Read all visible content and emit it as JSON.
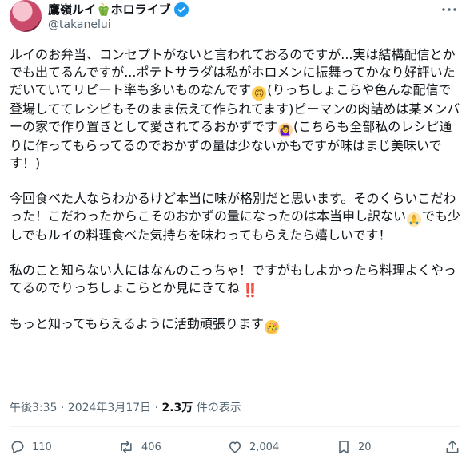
{
  "author": {
    "display_name": "鷹嶺ルイ🫑ホロライブ",
    "handle": "@takanelui"
  },
  "post": {
    "paragraph1": {
      "text_a": "ルイのお弁当、コンセプトがないと言われておるのですが...実は結構配信とかでも出てるんですが...ポテトサラダは私がホロメンに振舞ってかなり好評いただいていてリピート率も多いものなんです",
      "emoji_a": "🙃",
      "text_b": "(りっちしょこらや色んな配信で登場しててレシピもそのまま伝えて作られてます)ピーマンの肉詰めは某メンバーの家で作り置きとして愛されてるおかずです",
      "emoji_b": "🙋‍♀️",
      "text_c": "(こちらも全部私のレシピ通りに作ってもらってるのでおかずの量は少ないかもですが味はまじ美味いです！)"
    },
    "paragraph2": {
      "text_a": "今回食べた人ならわかるけど本当に味が格別だと思います。そのくらいこだわった！こだわったからこそのおかずの量になったのは本当申し訳ない",
      "emoji_a": "🙏",
      "text_b": "でも少しでもルイの料理食べた気持ちを味わってもらえたら嬉しいです！"
    },
    "paragraph3": {
      "text_a": "私のこと知らない人にはなんのこっちゃ！ですがもしよかったら料理よくやってるのでりっちしょこらとか見にきてね",
      "emoji_a": "‼️"
    },
    "paragraph4": {
      "text_a": "もっと知ってもらえるように活動頑張ります",
      "emoji_a": "🥳"
    }
  },
  "meta": {
    "timestamp": "午後3:35 · 2024年3月17日",
    "separator": " · ",
    "views_count": "2.3万",
    "views_label": " 件の表示"
  },
  "actions": {
    "reply_count": "110",
    "repost_count": "406",
    "like_count": "2,004",
    "bookmark_count": "20"
  },
  "icons": {
    "verified": "verified-badge-icon",
    "more": "more-icon",
    "reply": "reply-icon",
    "repost": "repost-icon",
    "like": "like-icon",
    "bookmark": "bookmark-icon",
    "share": "share-icon"
  },
  "colors": {
    "verified": "#1d9bf0",
    "text": "#0f1419",
    "muted": "#536471"
  }
}
